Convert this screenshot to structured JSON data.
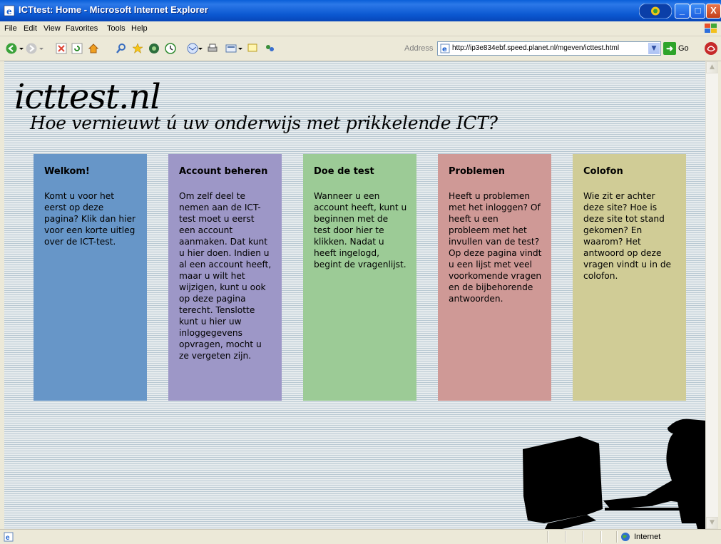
{
  "window": {
    "title": "ICTtest: Home - Microsoft Internet Explorer",
    "min": "_",
    "max": "□",
    "close": "X"
  },
  "menu": [
    "File",
    "Edit",
    "View",
    "Favorites",
    "Tools",
    "Help"
  ],
  "toolbar": {
    "address_label": "Address",
    "url": "http://ip3e834ebf.speed.planet.nl/mgeven/icttest.html",
    "go_label": "Go"
  },
  "site": {
    "title": "icttest.nl",
    "tagline": "Hoe vernieuwt ú uw onderwijs met prikkelende ICT?"
  },
  "cards": [
    {
      "title": "Welkom!",
      "text": "Komt u voor het eerst op deze pagina? Klik dan hier voor een korte uitleg over de ICT-test.",
      "color": "#6796c8"
    },
    {
      "title": "Account beheren",
      "text": "Om zelf deel te nemen aan de ICT-test moet u eerst een account aanmaken. Dat kunt u hier doen. Indien u al een account heeft, maar u wilt het wijzigen, kunt u ook op deze pagina terecht. Tenslotte kunt u hier uw inloggegevens opvragen, mocht u ze vergeten zijn.",
      "color": "#9d97c7"
    },
    {
      "title": "Doe de test",
      "text": "Wanneer u een account heeft, kunt u beginnen met de test door hier te klikken. Nadat u heeft ingelogd, begint de vragenlijst.",
      "color": "#9ccb96"
    },
    {
      "title": "Problemen",
      "text": "Heeft u problemen met het inloggen? Of heeft u een probleem met het invullen van de test? Op deze pagina vindt u een lijst met veel voorkomende vragen en de bijbehorende antwoorden.",
      "color": "#cf9996"
    },
    {
      "title": "Colofon",
      "text": "Wie zit er achter deze site? Hoe is deze site tot stand gekomen? En waarom? Het antwoord op deze vragen vindt u in de colofon.",
      "color": "#d0cc96"
    }
  ],
  "status": {
    "zone": "Internet"
  }
}
